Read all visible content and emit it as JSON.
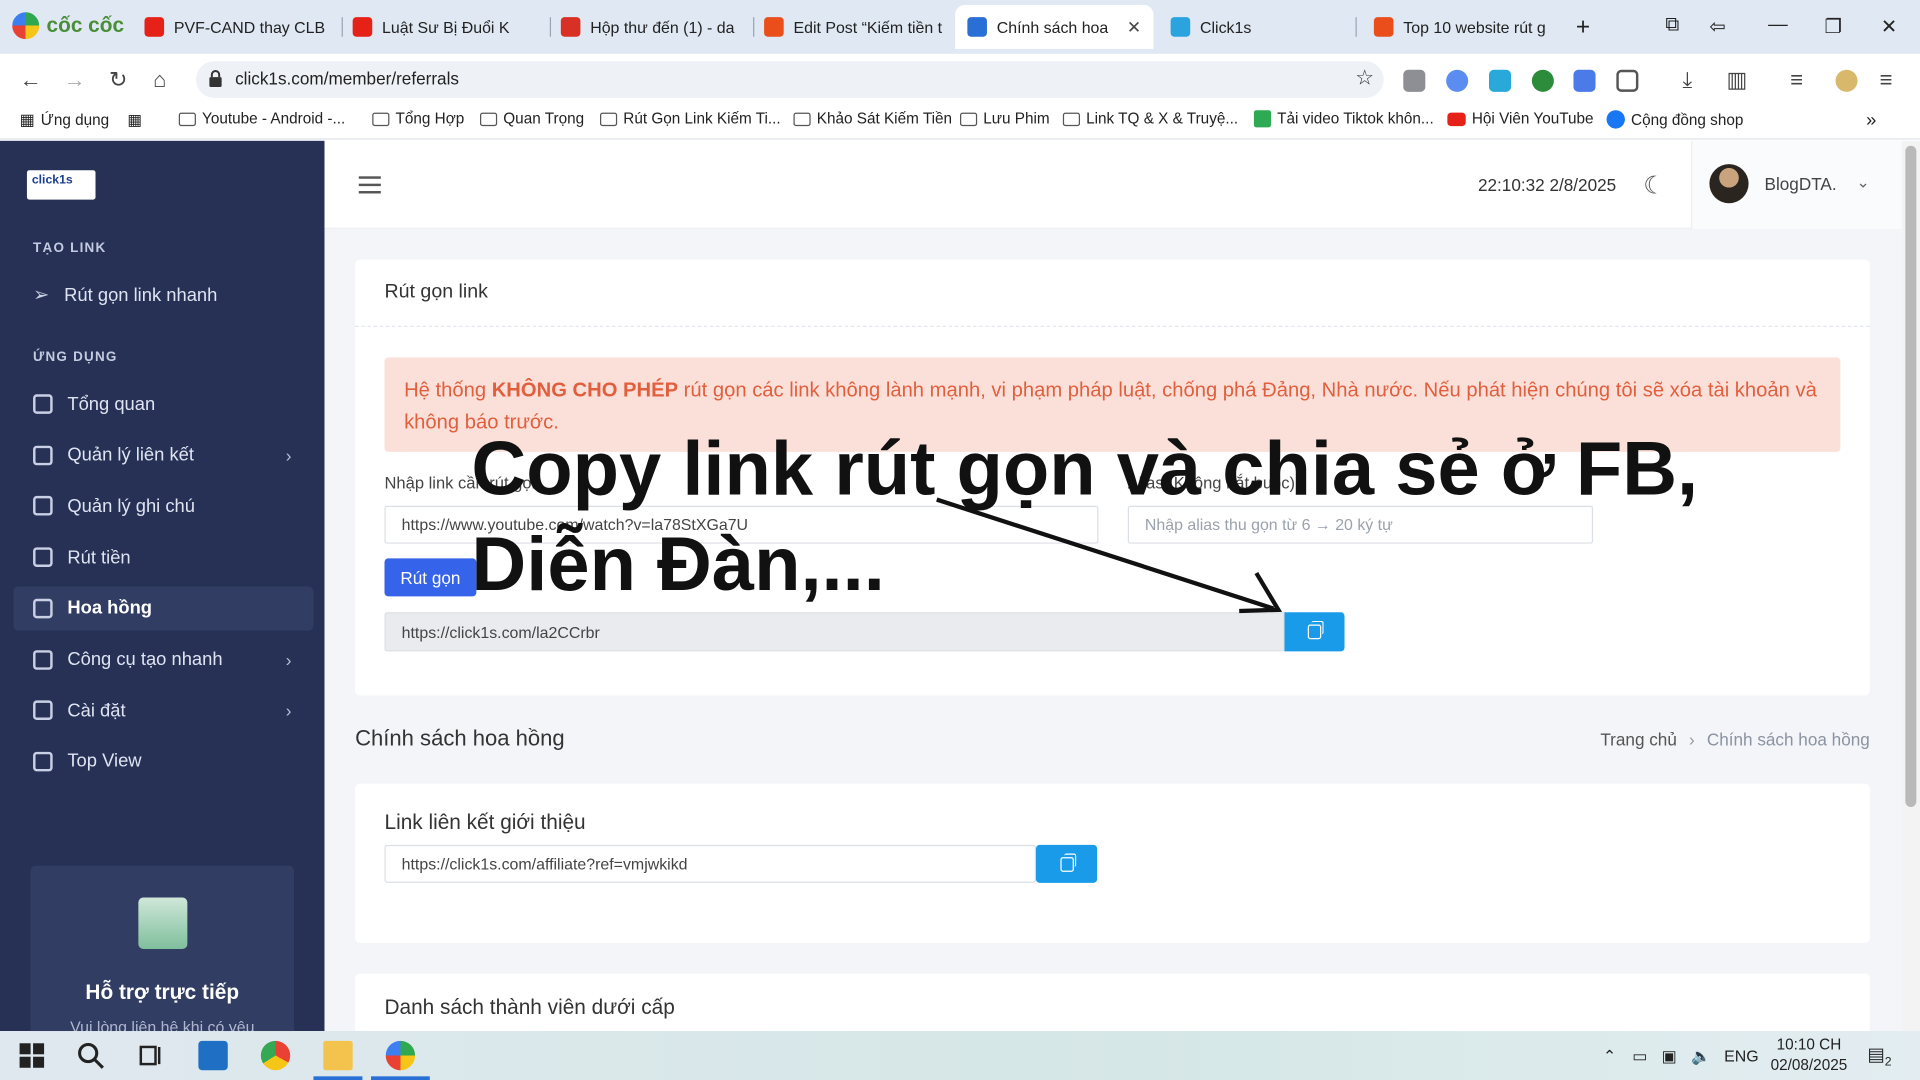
{
  "browser": {
    "brand": "cốc cốc",
    "tabs": [
      {
        "label": "PVF-CAND thay CLB",
        "color": "#e62117"
      },
      {
        "label": "Luật Sư Bị Đuổi K",
        "color": "#e62117"
      },
      {
        "label": "Hộp thư đến (1) - da",
        "color": "#d93025"
      },
      {
        "label": "Edit Post “Kiếm tiền t",
        "color": "#e94e1b"
      },
      {
        "label": "Chính sách hoa",
        "color": "#2a6fd6",
        "active": true
      },
      {
        "label": "Click1s",
        "color": "#2aa3df"
      },
      {
        "label": "Top 10 website rút g",
        "color": "#e94e1b"
      }
    ],
    "url": "click1s.com/member/referrals",
    "bookmarks": [
      "Ứng dụng",
      "Youtube - Android -...",
      "Tổng Hợp",
      "Quan Trọng",
      "Rút Gọn Link Kiếm Ti...",
      "Khảo Sát Kiếm Tiền",
      "Lưu Phim",
      "Link TQ & X & Truyệ...",
      "Tải video Tiktok khôn...",
      "Hội Viên YouTube",
      "Cộng đồng shop"
    ]
  },
  "sidebar": {
    "logo": "click1s",
    "section_create": "TẠO LINK",
    "section_apps": "ỨNG DỤNG",
    "quick": "Rút gọn link nhanh",
    "items": [
      {
        "label": "Tổng quan",
        "chevron": false
      },
      {
        "label": "Quản lý liên kết",
        "chevron": true
      },
      {
        "label": "Quản lý ghi chú",
        "chevron": false
      },
      {
        "label": "Rút tiền",
        "chevron": false
      },
      {
        "label": "Hoa hồng",
        "chevron": false,
        "active": true
      },
      {
        "label": "Công cụ tạo nhanh",
        "chevron": true
      },
      {
        "label": "Cài đặt",
        "chevron": true
      },
      {
        "label": "Top View",
        "chevron": false
      }
    ],
    "support_title": "Hỗ trợ trực tiếp",
    "support_sub": "Vui lòng liên hệ khi có yêu"
  },
  "header": {
    "clock": "22:10:32 2/8/2025",
    "user": "BlogDTA."
  },
  "shorten": {
    "title": "Rút gọn link",
    "alert_pre": "Hệ thống ",
    "alert_strong": "KHÔNG CHO PHÉP",
    "alert_post": " rút gọn các link không lành mạnh, vi phạm pháp luật, chống phá Đảng, Nhà nước. Nếu phát hiện chúng tôi sẽ xóa tài khoản và không báo trước.",
    "url_label": "Nhập link cần rút gọn",
    "url_value": "https://www.youtube.com/watch?v=la78StXGa7U",
    "alias_label": "Alias (Không bắt buộc)",
    "alias_placeholder": "Nhập alias thu gọn từ 6 → 20 ký tự",
    "button": "Rút gọn",
    "result": "https://click1s.com/la2CCrbr"
  },
  "page": {
    "title": "Chính sách hoa hồng",
    "crumb_home": "Trang chủ",
    "crumb_current": "Chính sách hoa hồng"
  },
  "referral": {
    "title": "Link liên kết giới thiệu",
    "link": "https://click1s.com/affiliate?ref=vmjwkikd"
  },
  "members": {
    "title": "Danh sách thành viên dưới cấp"
  },
  "overlay": {
    "line1": "Copy link rút gọn và chia sẻ ở FB,",
    "line2": "Diễn Đàn,..."
  },
  "taskbar": {
    "lang": "ENG",
    "time": "10:10 CH",
    "date": "02/08/2025",
    "notif": "2"
  }
}
